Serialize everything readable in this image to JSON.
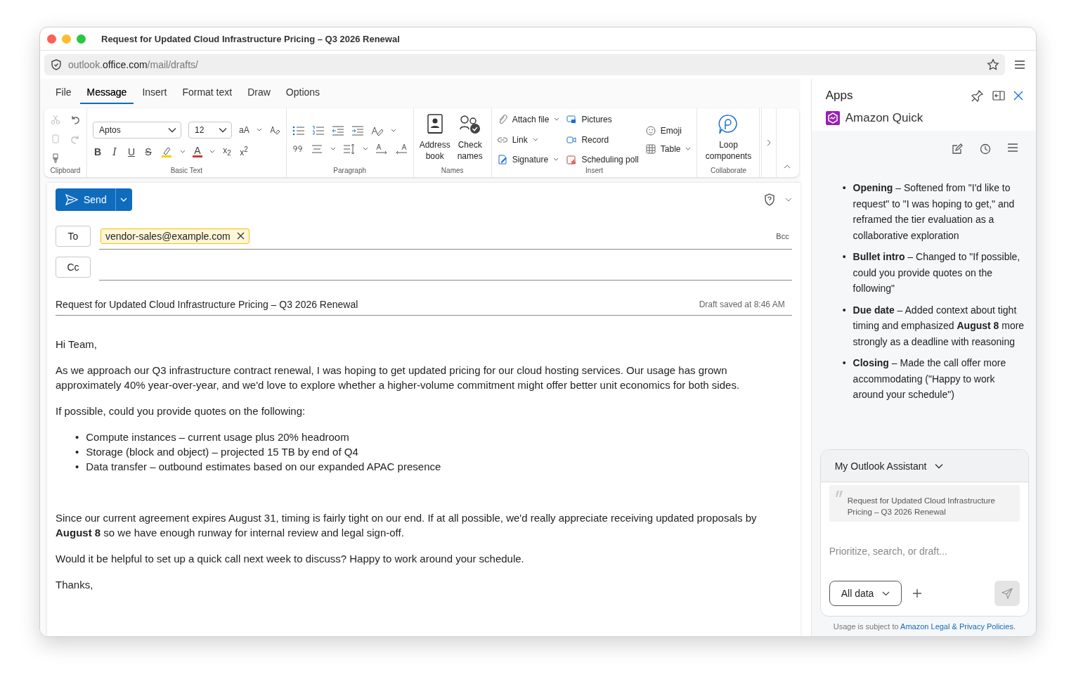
{
  "window": {
    "title": "Request for Updated Cloud Infrastructure Pricing – Q3 2026 Renewal"
  },
  "address_bar": {
    "url_parts": [
      {
        "text": "outlook.",
        "emphasis": false
      },
      {
        "text": "office.com",
        "emphasis": true
      },
      {
        "text": "/mail/drafts/",
        "emphasis": false
      }
    ]
  },
  "menu_tabs": [
    {
      "label": "File",
      "selected": false
    },
    {
      "label": "Message",
      "selected": true
    },
    {
      "label": "Insert",
      "selected": false
    },
    {
      "label": "Format text",
      "selected": false
    },
    {
      "label": "Draw",
      "selected": false
    },
    {
      "label": "Options",
      "selected": false
    }
  ],
  "ribbon": {
    "clipboard": {
      "label": "Clipboard"
    },
    "basic_text": {
      "label": "Basic Text",
      "font": "Aptos",
      "size": "12",
      "grow_glyph": "aA",
      "style_glyphs": [
        "B",
        "I",
        "U",
        "S"
      ],
      "font_color_glyph": "A",
      "subscript": "x$_{2}$",
      "superscript": "x$^{2}$"
    },
    "paragraph": {
      "label": "Paragraph"
    },
    "names": {
      "label": "Names",
      "buttons": [
        "Address book",
        "Check names"
      ]
    },
    "insert": {
      "label": "Insert",
      "columns": [
        [
          {
            "label": "Attach file",
            "dropdown": true
          },
          {
            "label": "Link",
            "dropdown": true
          },
          {
            "label": "Signature",
            "dropdown": true
          }
        ],
        [
          {
            "label": "Pictures",
            "dropdown": false
          },
          {
            "label": "Record",
            "dropdown": false
          },
          {
            "label": "Scheduling poll",
            "dropdown": false
          }
        ],
        [
          {
            "label": "Emoji",
            "dropdown": false
          },
          {
            "label": "Table",
            "dropdown": true
          }
        ]
      ]
    },
    "collaborate": {
      "label": "Collaborate",
      "buttons": [
        "Loop components"
      ]
    }
  },
  "compose": {
    "send": "Send",
    "to_label": "To",
    "recipients": [
      "vendor-sales@example.com"
    ],
    "bcc": "Bcc",
    "cc_label": "Cc",
    "subject": "Request for Updated Cloud Infrastructure Pricing – Q3 2026 Renewal",
    "draft_status": "Draft saved at 8:46 AM",
    "body": [
      {
        "kind": "paragraph",
        "text": "Hi Team,"
      },
      {
        "kind": "paragraph",
        "text": "As we approach our Q3 infrastructure contract renewal, I was hoping to get updated pricing for our cloud hosting services. Our usage has grown approximately 40% year-over-year, and we'd love to explore whether a higher-volume commitment might offer better unit economics for both sides."
      },
      {
        "kind": "paragraph",
        "text": "If possible, could you provide quotes on the following:"
      },
      {
        "kind": "list",
        "items": [
          {
            "marker": "•",
            "text": "Compute instances – current usage plus 20% headroom"
          },
          {
            "marker": "•",
            "text": "Storage (block and object) – projected 15 TB by end of Q4"
          },
          {
            "marker": "•",
            "text": "Data transfer – outbound estimates based on our expanded APAC presence"
          }
        ]
      },
      {
        "kind": "paragraph",
        "text": "Since our current agreement expires August 31, timing is fairly tight on our end. If at all possible, we'd really appreciate receiving updated proposals by **August 8** so we have enough runway for internal review and legal sign-off."
      },
      {
        "kind": "paragraph",
        "text": "Would it be helpful to set up a quick call next week to discuss? Happy to work around your schedule."
      },
      {
        "kind": "paragraph",
        "text": "Thanks,"
      }
    ]
  },
  "side_panel": {
    "title": "Apps",
    "app": {
      "name": "Amazon Quick"
    },
    "changes": [
      {
        "marker": "•",
        "text": "**Opening** – Softened from \"I'd like to request\" to \"I was hoping to get,\" and reframed the tier evaluation as a collaborative exploration"
      },
      {
        "marker": "•",
        "text": "**Bullet intro** – Changed to \"If possible, could you provide quotes on the following\""
      },
      {
        "marker": "•",
        "text": "**Due date** – Added context about tight timing and emphasized **August 8** more strongly as a deadline with reasoning"
      },
      {
        "marker": "•",
        "text": "**Closing** – Made the call offer more accommodating (\"Happy to work around your schedule\")"
      }
    ],
    "assistant": {
      "name": "My Outlook Assistant",
      "quote": "Request for Updated Cloud Infrastructure Pricing – Q3 2026 Renewal",
      "placeholder": "Prioritize, search, or draft...",
      "scope": "All data"
    },
    "footer": {
      "text": "Usage is subject to ",
      "link": "Amazon Legal & Privacy Policies",
      "end": "."
    }
  }
}
